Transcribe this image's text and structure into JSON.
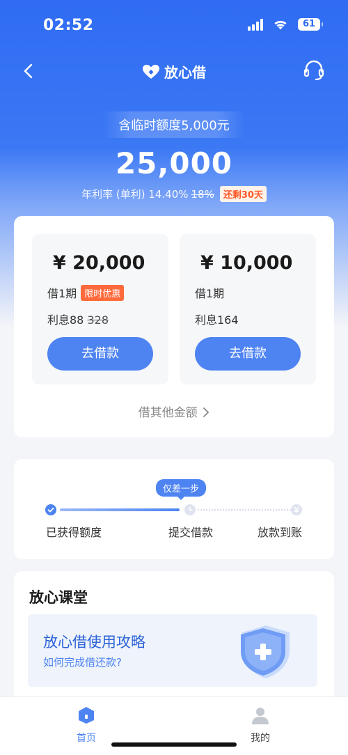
{
  "status_bar": {
    "time": "02:52",
    "battery": "61"
  },
  "nav": {
    "brand_name": "放心借"
  },
  "hero": {
    "temp_quota": "含临时额度5,000元",
    "amount": "25,000",
    "rate_text": "年利率 (单利) 14.40%",
    "rate_old": "18%",
    "rate_badge": "还剩30天"
  },
  "offers": [
    {
      "amount": "¥ 20,000",
      "term": "借1期",
      "badge": "限时优惠",
      "interest_label": "利息88",
      "interest_old": "328",
      "button": "去借款"
    },
    {
      "amount": "¥ 10,000",
      "term": "借1期",
      "interest_label": "利息164",
      "button": "去借款"
    }
  ],
  "other_amount": "借其他金额",
  "progress": {
    "hint": "仅差一步",
    "steps": [
      "已获得额度",
      "提交借款",
      "放款到账"
    ],
    "completed_steps": 1
  },
  "class_section": {
    "title": "放心课堂",
    "guide_title": "放心借使用攻略",
    "guide_subtitle": "如何完成借还款?"
  },
  "tab_bar": {
    "home": "首页",
    "mine": "我的"
  },
  "colors": {
    "primary": "#4e83f2",
    "hero_top": "#2f6cf3",
    "badge_orange": "#ff6a3c"
  }
}
